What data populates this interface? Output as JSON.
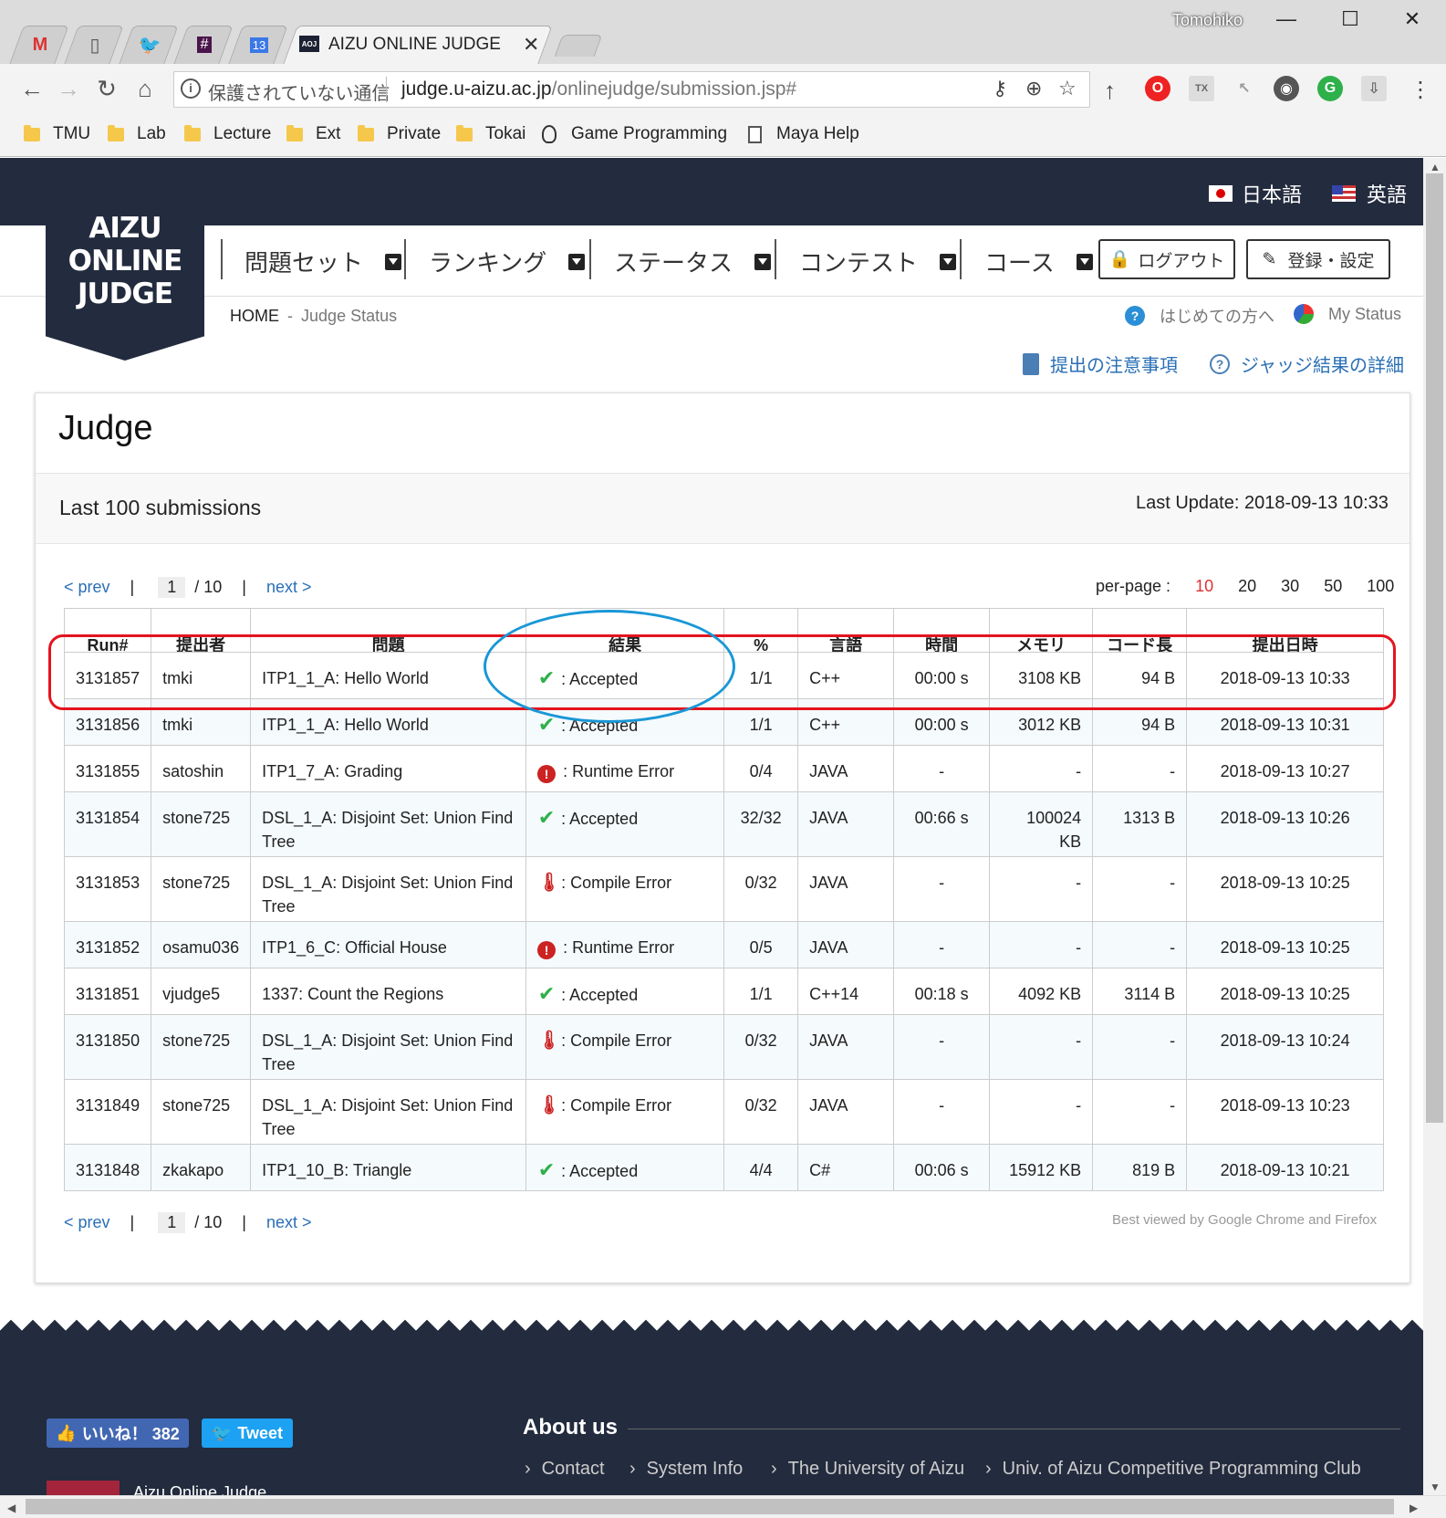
{
  "browser": {
    "active_tab_title": "AIZU ONLINE JUDGE",
    "tab_icon_calendar": "13",
    "user": "Tomohiko",
    "insecure_label": "保護されていない通信",
    "url_host": "judge.u-aizu.ac.jp",
    "url_path": "/onlinejudge/submission.jsp#",
    "bookmarks": [
      "TMU",
      "Lab",
      "Lecture",
      "Ext",
      "Private",
      "Tokai",
      "Game Programming",
      "Maya Help"
    ]
  },
  "header": {
    "logo_lines": [
      "AIZU",
      "ONLINE",
      "JUDGE"
    ],
    "lang_ja": "日本語",
    "lang_en": "英語",
    "menu": [
      "問題セット",
      "ランキング",
      "ステータス",
      "コンテスト",
      "コース"
    ],
    "logout": "ログアウト",
    "settings": "登録・設定"
  },
  "breadcrumb": {
    "home": "HOME",
    "sep": "-",
    "current": "Judge Status"
  },
  "help": {
    "beginner": "はじめての方へ",
    "my_status": "My Status"
  },
  "info_links": {
    "notes": "提出の注意事項",
    "details": "ジャッジ結果の詳細"
  },
  "panel": {
    "title": "Judge",
    "subtitle": "Last 100 submissions",
    "last_update": "Last Update: 2018-09-13 10:33"
  },
  "pager": {
    "prev": "< prev",
    "next": "next >",
    "sep": "|",
    "page": "1",
    "total": "/ 10"
  },
  "per_page": {
    "label": "per-page :",
    "options": [
      "10",
      "20",
      "30",
      "50",
      "100"
    ],
    "active": "10"
  },
  "table": {
    "headers": [
      "Run#",
      "提出者",
      "問題",
      "結果",
      "%",
      "言語",
      "時間",
      "メモリ",
      "コード長",
      "提出日時"
    ],
    "rows": [
      {
        "run": "3131857",
        "user": "tmki",
        "problem": "ITP1_1_A: Hello World",
        "status": "ok",
        "result": ": Accepted",
        "pct": "1/1",
        "lang": "C++",
        "time": "00:00 s",
        "mem": "3108 KB",
        "code": "94 B",
        "date": "2018-09-13 10:33"
      },
      {
        "run": "3131856",
        "user": "tmki",
        "problem": "ITP1_1_A: Hello World",
        "status": "ok",
        "result": ": Accepted",
        "pct": "1/1",
        "lang": "C++",
        "time": "00:00 s",
        "mem": "3012 KB",
        "code": "94 B",
        "date": "2018-09-13 10:31"
      },
      {
        "run": "3131855",
        "user": "satoshin",
        "problem": "ITP1_7_A: Grading",
        "status": "re",
        "result": ": Runtime Error",
        "pct": "0/4",
        "lang": "JAVA",
        "time": "-",
        "mem": "-",
        "code": "-",
        "date": "2018-09-13 10:27"
      },
      {
        "run": "3131854",
        "user": "stone725",
        "problem": "DSL_1_A: Disjoint Set: Union Find Tree",
        "status": "ok",
        "result": ": Accepted",
        "pct": "32/32",
        "lang": "JAVA",
        "time": "00:66 s",
        "mem": "100024 KB",
        "code": "1313 B",
        "date": "2018-09-13 10:26"
      },
      {
        "run": "3131853",
        "user": "stone725",
        "problem": "DSL_1_A: Disjoint Set: Union Find Tree",
        "status": "ce",
        "result": ": Compile Error",
        "pct": "0/32",
        "lang": "JAVA",
        "time": "-",
        "mem": "-",
        "code": "-",
        "date": "2018-09-13 10:25"
      },
      {
        "run": "3131852",
        "user": "osamu036",
        "problem": "ITP1_6_C: Official House",
        "status": "re",
        "result": ": Runtime Error",
        "pct": "0/5",
        "lang": "JAVA",
        "time": "-",
        "mem": "-",
        "code": "-",
        "date": "2018-09-13 10:25"
      },
      {
        "run": "3131851",
        "user": "vjudge5",
        "problem": "1337: Count the Regions",
        "status": "ok",
        "result": ": Accepted",
        "pct": "1/1",
        "lang": "C++14",
        "time": "00:18 s",
        "mem": "4092 KB",
        "code": "3114 B",
        "date": "2018-09-13 10:25"
      },
      {
        "run": "3131850",
        "user": "stone725",
        "problem": "DSL_1_A: Disjoint Set: Union Find Tree",
        "status": "ce",
        "result": ": Compile Error",
        "pct": "0/32",
        "lang": "JAVA",
        "time": "-",
        "mem": "-",
        "code": "-",
        "date": "2018-09-13 10:24"
      },
      {
        "run": "3131849",
        "user": "stone725",
        "problem": "DSL_1_A: Disjoint Set: Union Find Tree",
        "status": "ce",
        "result": ": Compile Error",
        "pct": "0/32",
        "lang": "JAVA",
        "time": "-",
        "mem": "-",
        "code": "-",
        "date": "2018-09-13 10:23"
      },
      {
        "run": "3131848",
        "user": "zkakapo",
        "problem": "ITP1_10_B: Triangle",
        "status": "ok",
        "result": ": Accepted",
        "pct": "4/4",
        "lang": "C#",
        "time": "00:06 s",
        "mem": "15912 KB",
        "code": "819 B",
        "date": "2018-09-13 10:21"
      }
    ]
  },
  "best_viewed": "Best viewed by Google Chrome and Firefox",
  "footer": {
    "like": "いいね！ 382",
    "tweet": "Tweet",
    "about": "About us",
    "links": [
      "Contact",
      "System Info",
      "The University of Aizu",
      "Univ. of Aizu Competitive Programming Club"
    ],
    "brand": "Aizu Online Judge"
  },
  "colors": {
    "nav_dark": "#232b3e",
    "link": "#2a6fb5",
    "accepted": "#2eb04a",
    "error": "#cc2222",
    "highlight_red": "#e3141e",
    "highlight_blue": "#1997d6"
  }
}
